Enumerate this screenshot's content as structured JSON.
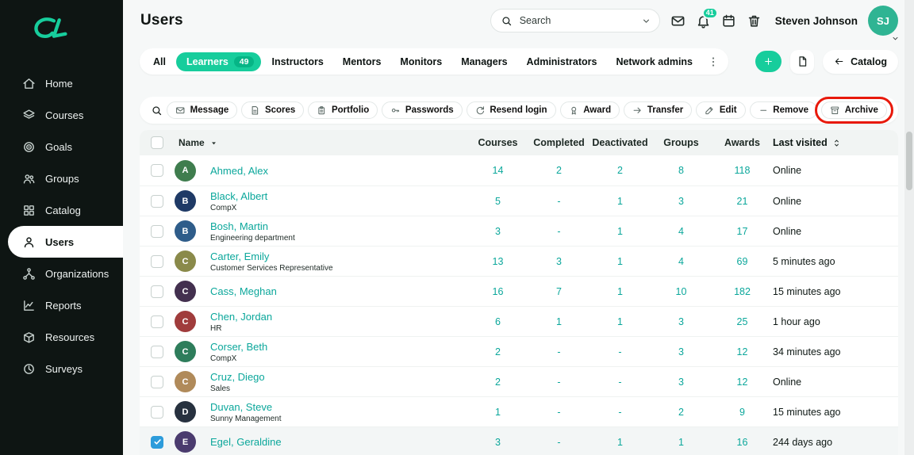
{
  "colors": {
    "accent": "#17CD9C",
    "accent_dark": "#06B586",
    "link": "#0BA79B",
    "sidebar_bg": "#0E1513",
    "highlight_ring": "#E8190B",
    "checkbox_checked": "#2D9CDB",
    "header_avatar": "#2FB493"
  },
  "sidebar": {
    "items": [
      {
        "label": "Home",
        "icon": "home",
        "active": false
      },
      {
        "label": "Courses",
        "icon": "courses",
        "active": false
      },
      {
        "label": "Goals",
        "icon": "goals",
        "active": false
      },
      {
        "label": "Groups",
        "icon": "groups",
        "active": false
      },
      {
        "label": "Catalog",
        "icon": "catalog",
        "active": false
      },
      {
        "label": "Users",
        "icon": "users",
        "active": true
      },
      {
        "label": "Organizations",
        "icon": "organizations",
        "active": false
      },
      {
        "label": "Reports",
        "icon": "reports",
        "active": false
      },
      {
        "label": "Resources",
        "icon": "resources",
        "active": false
      },
      {
        "label": "Surveys",
        "icon": "surveys",
        "active": false
      }
    ]
  },
  "header": {
    "title": "Users",
    "search_placeholder": "Search",
    "notification_count": "41",
    "user_name": "Steven Johnson"
  },
  "tabs": [
    {
      "label": "All",
      "active": false
    },
    {
      "label": "Learners",
      "count": "49",
      "active": true
    },
    {
      "label": "Instructors",
      "active": false
    },
    {
      "label": "Mentors",
      "active": false
    },
    {
      "label": "Monitors",
      "active": false
    },
    {
      "label": "Managers",
      "active": false
    },
    {
      "label": "Administrators",
      "active": false
    },
    {
      "label": "Network admins",
      "active": false
    }
  ],
  "actions": {
    "catalog_label": "Catalog"
  },
  "toolbar": [
    {
      "label": "Message",
      "icon": "envelope",
      "highlighted": false
    },
    {
      "label": "Scores",
      "icon": "scores",
      "highlighted": false
    },
    {
      "label": "Portfolio",
      "icon": "portfolio",
      "highlighted": false
    },
    {
      "label": "Passwords",
      "icon": "key",
      "highlighted": false
    },
    {
      "label": "Resend login",
      "icon": "refresh",
      "highlighted": false
    },
    {
      "label": "Award",
      "icon": "award",
      "highlighted": false
    },
    {
      "label": "Transfer",
      "icon": "arrow-right",
      "highlighted": false
    },
    {
      "label": "Edit",
      "icon": "pencil",
      "highlighted": false
    },
    {
      "label": "Remove",
      "icon": "minus",
      "highlighted": false
    },
    {
      "label": "Archive",
      "icon": "archive",
      "highlighted": true
    }
  ],
  "table": {
    "columns": {
      "name": "Name",
      "courses": "Courses",
      "completed": "Completed",
      "deactivated": "Deactivated",
      "groups": "Groups",
      "awards": "Awards",
      "last_visited": "Last visited"
    },
    "rows": [
      {
        "name": "Ahmed, Alex",
        "subtitle": "",
        "courses": "14",
        "completed": "2",
        "deactivated": "2",
        "groups": "8",
        "awards": "118",
        "last_visited": "Online",
        "checked": false,
        "avatar_color": "#3F7D4E"
      },
      {
        "name": "Black, Albert",
        "subtitle": "CompX",
        "courses": "5",
        "completed": "-",
        "deactivated": "1",
        "groups": "3",
        "awards": "21",
        "last_visited": "Online",
        "checked": false,
        "avatar_color": "#1F3A66"
      },
      {
        "name": "Bosh, Martin",
        "subtitle": "Engineering department",
        "courses": "3",
        "completed": "-",
        "deactivated": "1",
        "groups": "4",
        "awards": "17",
        "last_visited": "Online",
        "checked": false,
        "avatar_color": "#2F5D8A"
      },
      {
        "name": "Carter, Emily",
        "subtitle": "Customer Services Representative",
        "courses": "13",
        "completed": "3",
        "deactivated": "1",
        "groups": "4",
        "awards": "69",
        "last_visited": "5 minutes ago",
        "checked": false,
        "avatar_color": "#8A8A4A"
      },
      {
        "name": "Cass, Meghan",
        "subtitle": "",
        "courses": "16",
        "completed": "7",
        "deactivated": "1",
        "groups": "10",
        "awards": "182",
        "last_visited": "15 minutes ago",
        "checked": false,
        "avatar_color": "#43304F"
      },
      {
        "name": "Chen, Jordan",
        "subtitle": "HR",
        "courses": "6",
        "completed": "1",
        "deactivated": "1",
        "groups": "3",
        "awards": "25",
        "last_visited": "1 hour ago",
        "checked": false,
        "avatar_color": "#A03C3C"
      },
      {
        "name": "Corser, Beth",
        "subtitle": "CompX",
        "courses": "2",
        "completed": "-",
        "deactivated": "-",
        "groups": "3",
        "awards": "12",
        "last_visited": "34 minutes ago",
        "checked": false,
        "avatar_color": "#2E7D5B"
      },
      {
        "name": "Cruz, Diego",
        "subtitle": "Sales",
        "courses": "2",
        "completed": "-",
        "deactivated": "-",
        "groups": "3",
        "awards": "12",
        "last_visited": "Online",
        "checked": false,
        "avatar_color": "#B08A5A"
      },
      {
        "name": "Duvan, Steve",
        "subtitle": "Sunny Management",
        "courses": "1",
        "completed": "-",
        "deactivated": "-",
        "groups": "2",
        "awards": "9",
        "last_visited": "15 minutes ago",
        "checked": false,
        "avatar_color": "#27313F"
      },
      {
        "name": "Egel, Geraldine",
        "subtitle": "",
        "courses": "3",
        "completed": "-",
        "deactivated": "1",
        "groups": "1",
        "awards": "16",
        "last_visited": "244 days ago",
        "checked": true,
        "avatar_color": "#4A3B6E"
      }
    ]
  }
}
